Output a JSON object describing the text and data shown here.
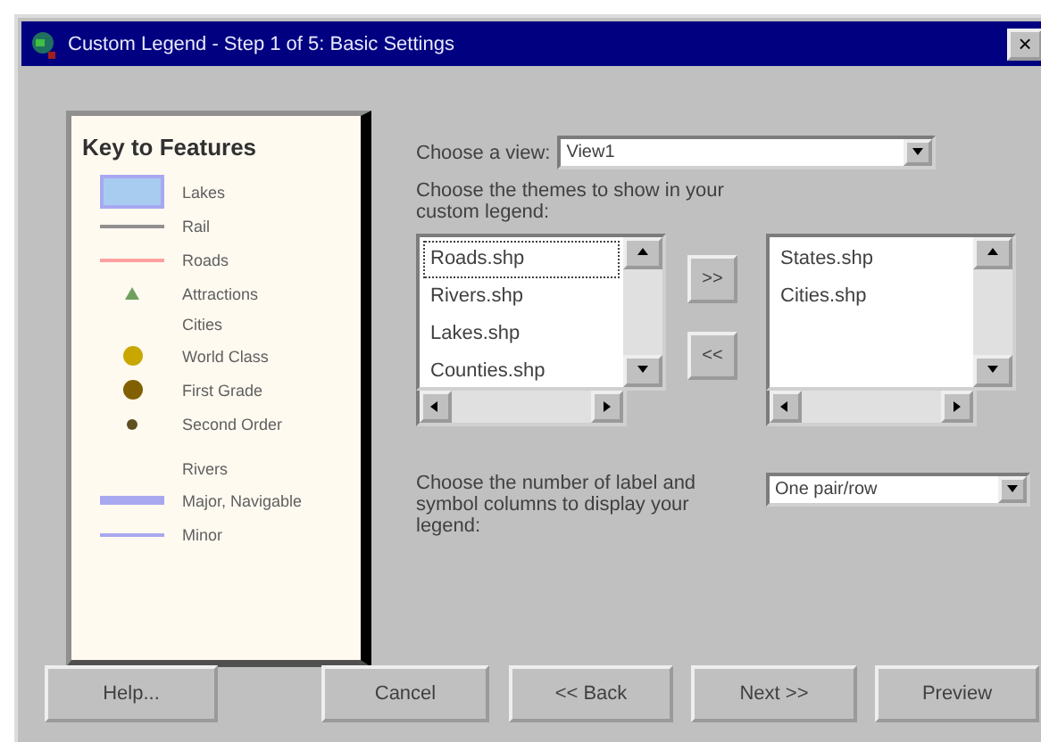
{
  "window": {
    "title": "Custom Legend - Step 1 of 5: Basic Settings",
    "close": "×"
  },
  "legend": {
    "title": "Key to Features",
    "items": [
      {
        "kind": "area",
        "label": "Lakes",
        "color": "#a8ccf0"
      },
      {
        "kind": "line",
        "label": "Rail",
        "color": "#909090"
      },
      {
        "kind": "line",
        "label": "Roads",
        "color": "#ffa0a0"
      },
      {
        "kind": "triangle",
        "label": "Attractions",
        "color": "#70a060"
      },
      {
        "kind": "heading",
        "label": "Cities"
      },
      {
        "kind": "dot",
        "label": "World Class",
        "color": "#c8a800"
      },
      {
        "kind": "dot",
        "label": "First Grade",
        "color": "#806000"
      },
      {
        "kind": "small-dot",
        "label": "Second Order",
        "color": "#605020"
      },
      {
        "kind": "heading",
        "label": "Rivers"
      },
      {
        "kind": "thick-line",
        "label": "Major, Navigable",
        "color": "#a8a8f0"
      },
      {
        "kind": "line",
        "label": "Minor",
        "color": "#a8a8f0"
      }
    ]
  },
  "view": {
    "label": "Choose a view:",
    "value": "View1"
  },
  "themes_label": "Choose the themes to show in your custom legend:",
  "available": [
    {
      "label": "Roads.shp",
      "selected": true
    },
    {
      "label": "Rivers.shp",
      "selected": false
    },
    {
      "label": "Lakes.shp",
      "selected": false
    },
    {
      "label": "Counties.shp",
      "selected": false
    }
  ],
  "add_button": ">>",
  "remove_button": "<<",
  "chosen": [
    {
      "label": "States.shp",
      "selected": false
    },
    {
      "label": "Cities.shp",
      "selected": false
    }
  ],
  "columns": {
    "label": "Choose the number of label and symbol columns to display your legend:",
    "value": "One pair/row"
  },
  "buttons": [
    "Help...",
    "Cancel",
    "<< Back",
    "Next >>",
    "Preview"
  ]
}
